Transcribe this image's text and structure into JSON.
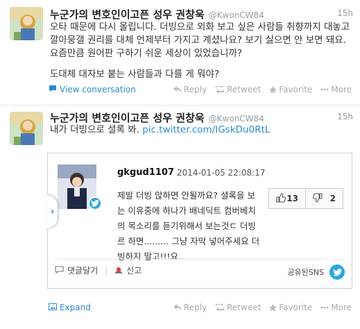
{
  "tweets": [
    {
      "name": "누군가의 변호인이고픈 성우 권창욱",
      "handle": "@KwonCW84",
      "time": "15h",
      "text": "오타 때문에 다시 올립니다. 더빙으로 외화 보고 싶은 사람들 취향까지 대놓고 깔아뭉갤 권리를 대체 언제부터 가지고 계셨나요? 보기 싫으면 안 보면 돼요. 요즘만큼 원어판 구하기 쉬운 세상이 있었습니까?",
      "text2": "도대체 대자보 붙는 사람들과 다를 게 뭐야?",
      "meta_link": "View conversation"
    },
    {
      "name": "누군가의 변호인이고픈 성우 권창욱",
      "handle": "@KwonCW84",
      "time": "15h",
      "text_prefix": "내가 더빙으로 셜록 봐. ",
      "text_link": "pic.twitter.com/IGskDu0RtL",
      "meta_link": "Expand"
    }
  ],
  "actions": {
    "reply": "Reply",
    "retweet": "Retweet",
    "favorite": "Favorite",
    "more": "More"
  },
  "card": {
    "user": "gkgud1107",
    "date": "2014-01-05 22:08:17",
    "text": "제발 더빙 않하면 안될까요? 셜록을 보는 이유중에 하나가 배네딕트 컴버베치의 목소리를 듣기위해서 보는것ㄷ 더빙르 하면......... 그냥 자막 넣어주세요 더빙하지 말고!!!요..",
    "up_count": "13",
    "down_count": "2",
    "comment_label": "댓글달기",
    "report_label": "신고",
    "shared_label": "공유된SNS"
  },
  "colors": {
    "link": "#2a8ad1",
    "twitter_blue": "#2aa9e0"
  }
}
